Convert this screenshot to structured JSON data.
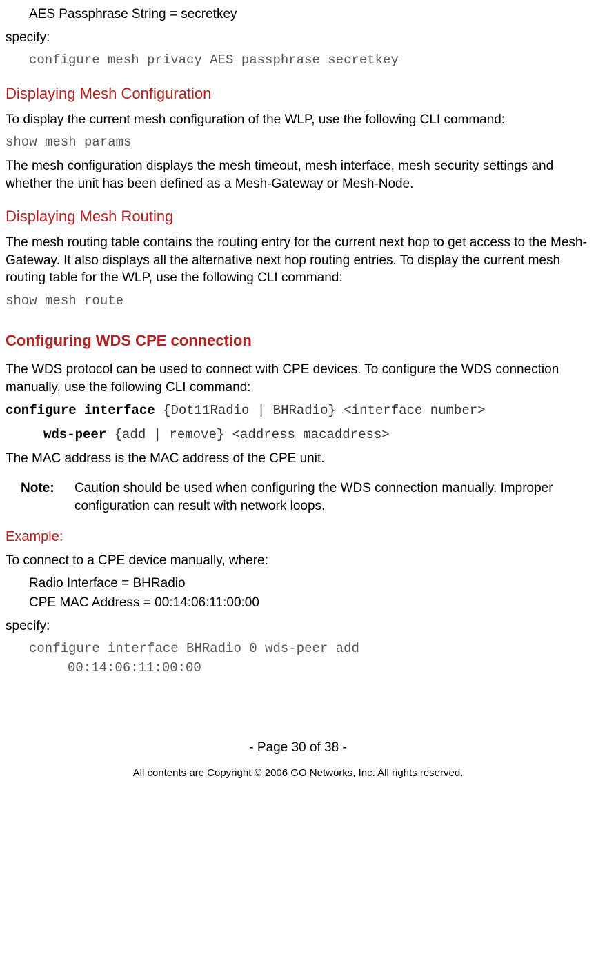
{
  "line1": "AES Passphrase String = secretkey",
  "specify": "specify:",
  "cmd1": "configure mesh privacy AES passphrase secretkey",
  "h1": "Displaying Mesh Configuration",
  "p1": "To display the current mesh configuration of the WLP, use the following CLI command:",
  "cmd2": "show mesh params",
  "p2": "The mesh configuration displays the mesh timeout, mesh interface, mesh security settings and whether the unit has been defined as a Mesh-Gateway or Mesh-Node.",
  "h2": "Displaying Mesh Routing",
  "p3": "The mesh routing table contains the routing entry for the current next hop to get access to the Mesh-Gateway. It also displays all the alternative next hop routing entries. To display the current mesh routing table for the WLP, use the following CLI command:",
  "cmd3": "show mesh route",
  "h3": "Configuring WDS CPE connection",
  "p4": "The WDS protocol can be used to connect with CPE devices. To configure the WDS connection manually, use the following CLI command:",
  "cmd4a_bold": "configure interface",
  "cmd4a_rest": " {Dot11Radio | BHRadio} <interface number>",
  "cmd4b_bold": "wds-peer",
  "cmd4b_rest": " {add | remove} <address macaddress>",
  "p5": "The MAC address is the MAC address of the CPE unit.",
  "note_label": "Note:",
  "note_text": "Caution should be used when configuring the WDS connection manually. Improper configuration can result with network loops.",
  "h4": "Example:",
  "p6": "To connect to a CPE device manually, where:",
  "ex1": "Radio Interface = BHRadio",
  "ex2": "CPE MAC Address = 00:14:06:11:00:00",
  "specify2": "specify:",
  "cmd5a": "configure interface BHRadio 0 wds-peer add",
  "cmd5b": "00:14:06:11:00:00",
  "pagenum": "- Page 30 of 38 -",
  "copyright": "All contents are Copyright © 2006 GO Networks, Inc. All rights reserved."
}
